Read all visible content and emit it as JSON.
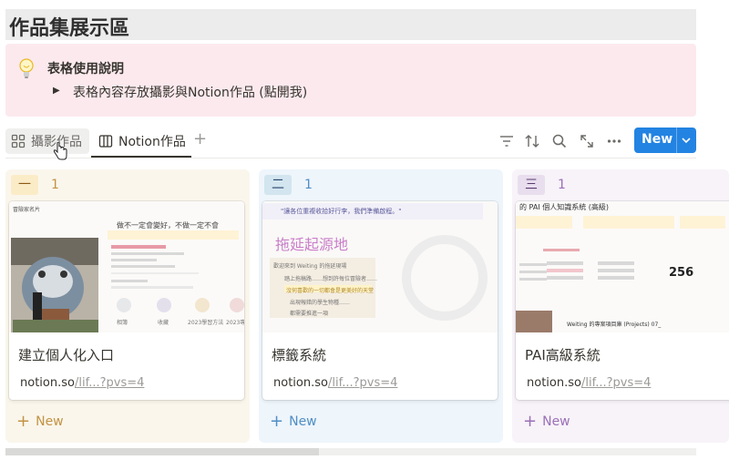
{
  "page": {
    "title": "作品集展示區"
  },
  "callout": {
    "title": "表格使用說明",
    "toggle_text": "表格內容存放攝影與Notion作品 (點開我)"
  },
  "views": {
    "tabs": [
      {
        "label": "攝影作品",
        "icon": "gallery-grid-icon",
        "active": false
      },
      {
        "label": "Notion作品",
        "icon": "board-icon",
        "active": true
      }
    ],
    "add_view_label": "+",
    "toolbar_icons": [
      "filter-icon",
      "sort-icon",
      "search-icon",
      "expand-icon",
      "more-icon"
    ],
    "new_button_label": "New"
  },
  "columns": [
    {
      "tag": "一",
      "count": "1",
      "tag_bg": "#fbecc8",
      "tag_color": "#8a5c14",
      "count_color": "#c29343",
      "new_label": "New",
      "new_color": "#c29343",
      "card": {
        "title": "建立個人化入口",
        "url_host": "notion.so",
        "url_path": "/lif...?pvs=4",
        "cover": {
          "header": "冒險家名片",
          "headline": "做不一定會變好，不做一定不會",
          "labels": [
            "相簿",
            "收藏",
            "2023學習方法",
            "2023專案項目"
          ]
        }
      }
    },
    {
      "tag": "二",
      "count": "1",
      "tag_bg": "#d3e5ef",
      "tag_color": "#28456c",
      "count_color": "#4f8ec4",
      "new_label": "New",
      "new_color": "#4f8ec4",
      "card": {
        "title": "標籤系統",
        "url_host": "notion.so",
        "url_path": "/lif...?pvs=4",
        "cover": {
          "header": "\"讓各位重複收拾好行李，我們準備啟程。\"",
          "headline": "拖延起源地",
          "lines": [
            "歡迎來到 Weiting 的拖延現場",
            "踏上拖稿路……想到許每位冒險者……",
            "沒何喜歡的一切都會是更美好的天堂",
            "出現報錯的學生物種……",
            "都需要推進一項"
          ]
        }
      }
    },
    {
      "tag": "三",
      "count": "1",
      "tag_bg": "#e8deee",
      "tag_color": "#5a3b6e",
      "count_color": "#9b6fb8",
      "new_label": "New",
      "new_color": "#9b6fb8",
      "card": {
        "title": "PAI高級系統",
        "url_host": "notion.so",
        "url_path": "/lif...?pvs=4",
        "cover": {
          "header": "的 PAI 個人知識系統 (高級)",
          "number": "256",
          "footer": "Weiting 的專案項目庫 (Projects) 07_"
        }
      }
    }
  ]
}
